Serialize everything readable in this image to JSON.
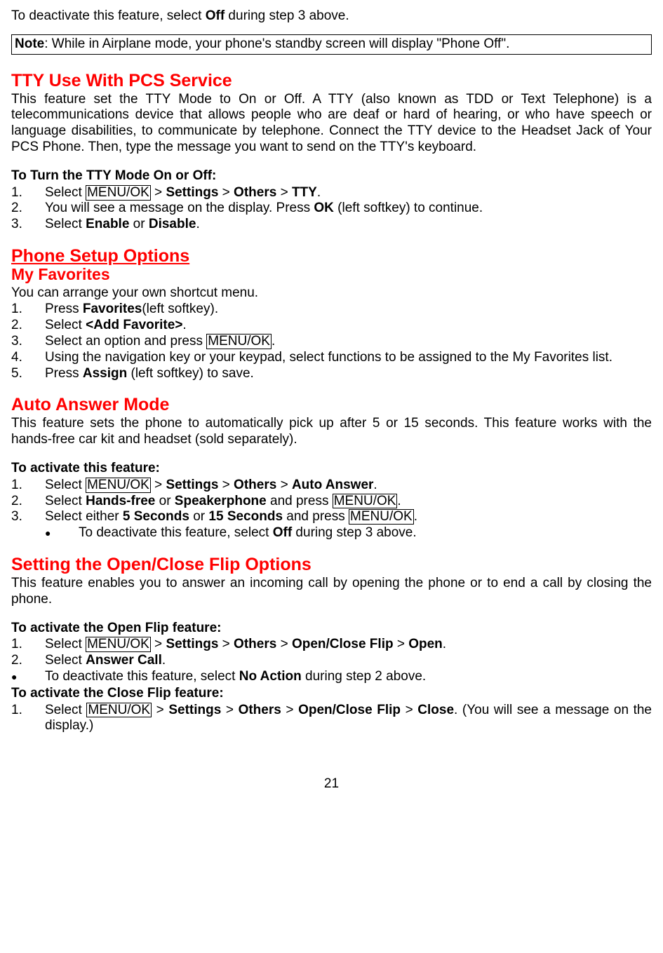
{
  "intro": {
    "pre": "To deactivate this feature, select ",
    "off": "Off",
    "post": " during step 3 above."
  },
  "note": {
    "label": "Note",
    "text": ": While in Airplane mode, your phone's standby screen will display \"Phone Off\"."
  },
  "tty": {
    "heading": "TTY Use With PCS Service",
    "para": "This feature set the TTY Mode to On or Off. A TTY (also known as TDD or Text Telephone) is a telecommunications device that allows people who are deaf or hard of hearing, or who have speech or language disabilities, to communicate by telephone. Connect the TTY device to the Headset Jack of Your PCS Phone. Then, type the message you want to send on the TTY's keyboard.",
    "sub": "To Turn the TTY Mode On or Off:",
    "steps": {
      "n1": "1.",
      "s1a": "Select ",
      "s1key": "MENU/OK",
      "s1b": " > ",
      "s1c": "Settings",
      "s1d": " > ",
      "s1e": "Others",
      "s1f": " > ",
      "s1g": "TTY",
      "s1h": ".",
      "n2": "2.",
      "s2a": "You will see a message on the display. Press ",
      "s2b": "OK",
      "s2c": " (left softkey) to continue.",
      "n3": "3.",
      "s3a": "Select ",
      "s3b": "Enable",
      "s3c": " or ",
      "s3d": "Disable",
      "s3e": "."
    }
  },
  "setup": {
    "heading": "Phone Setup Options"
  },
  "fav": {
    "heading": "My Favorites",
    "para": "You can arrange your own shortcut menu.",
    "steps": {
      "n1": "1.",
      "s1a": "Press ",
      "s1b": "Favorites",
      "s1c": "(left softkey).",
      "n2": "2.",
      "s2a": "Select ",
      "s2b": "<Add Favorite>",
      "s2c": ".",
      "n3": "3.",
      "s3a": "Select an option and press ",
      "s3key": "MENU/OK",
      "s3b": ".",
      "n4": "4.",
      "s4": "Using the navigation key or your keypad, select functions to be assigned to the My Favorites list.",
      "n5": "5.",
      "s5a": "Press ",
      "s5b": "Assign",
      "s5c": " (left softkey) to save."
    }
  },
  "auto": {
    "heading": "Auto Answer Mode",
    "para": "This feature sets the phone to automatically pick up after 5 or 15 seconds. This feature works with the hands-free car kit and headset (sold separately).",
    "sub": "To activate this feature:",
    "steps": {
      "n1": "1.",
      "s1a": "Select ",
      "s1key": "MENU/OK",
      "s1b": " > ",
      "s1c": "Settings",
      "s1d": " > ",
      "s1e": "Others",
      "s1f": " > ",
      "s1g": "Auto Answer",
      "s1h": ".",
      "n2": "2.",
      "s2a": "Select ",
      "s2b": "Hands-free",
      "s2c": " or ",
      "s2d": "Speakerphone",
      "s2e": " and press ",
      "s2key": "MENU/OK",
      "s2f": ".",
      "n3": "3.",
      "s3a": "Select either ",
      "s3b": "5 Seconds",
      "s3c": " or ",
      "s3d": "15 Seconds",
      "s3e": " and press ",
      "s3key": "MENU/OK",
      "s3f": ".",
      "bdot": "●",
      "ba": "To deactivate this feature, select ",
      "bb": "Off",
      "bc": " during step 3 above."
    }
  },
  "flip": {
    "heading": "Setting the Open/Close Flip Options",
    "para": "This feature enables you to answer an incoming call by opening the phone or to end a call by closing the phone.",
    "sub1": "To activate the Open Flip feature:",
    "open": {
      "n1": "1.",
      "s1a": "Select ",
      "s1key": "MENU/OK",
      "s1b": " > ",
      "s1c": "Settings",
      "s1d": " > ",
      "s1e": "Others",
      "s1f": " > ",
      "s1g": "Open/Close Flip",
      "s1h": " > ",
      "s1i": "Open",
      "s1j": ".",
      "n2": "2.",
      "s2a": "Select ",
      "s2b": "Answer Call",
      "s2c": ".",
      "bdot": "●",
      "ba": "To deactivate this feature, select ",
      "bb": "No Action",
      "bc": " during step 2 above."
    },
    "sub2": "To activate the Close Flip feature:",
    "close": {
      "n1": "1.",
      "s1a": "Select ",
      "s1key": "MENU/OK",
      "s1b": " > ",
      "s1c": "Settings",
      "s1d": " > ",
      "s1e": "Others",
      "s1f": " > ",
      "s1g": "Open/Close Flip",
      "s1h": " > ",
      "s1i": "Close",
      "s1j": ". (You will see a message on the display.)"
    }
  },
  "pagenum": "21"
}
